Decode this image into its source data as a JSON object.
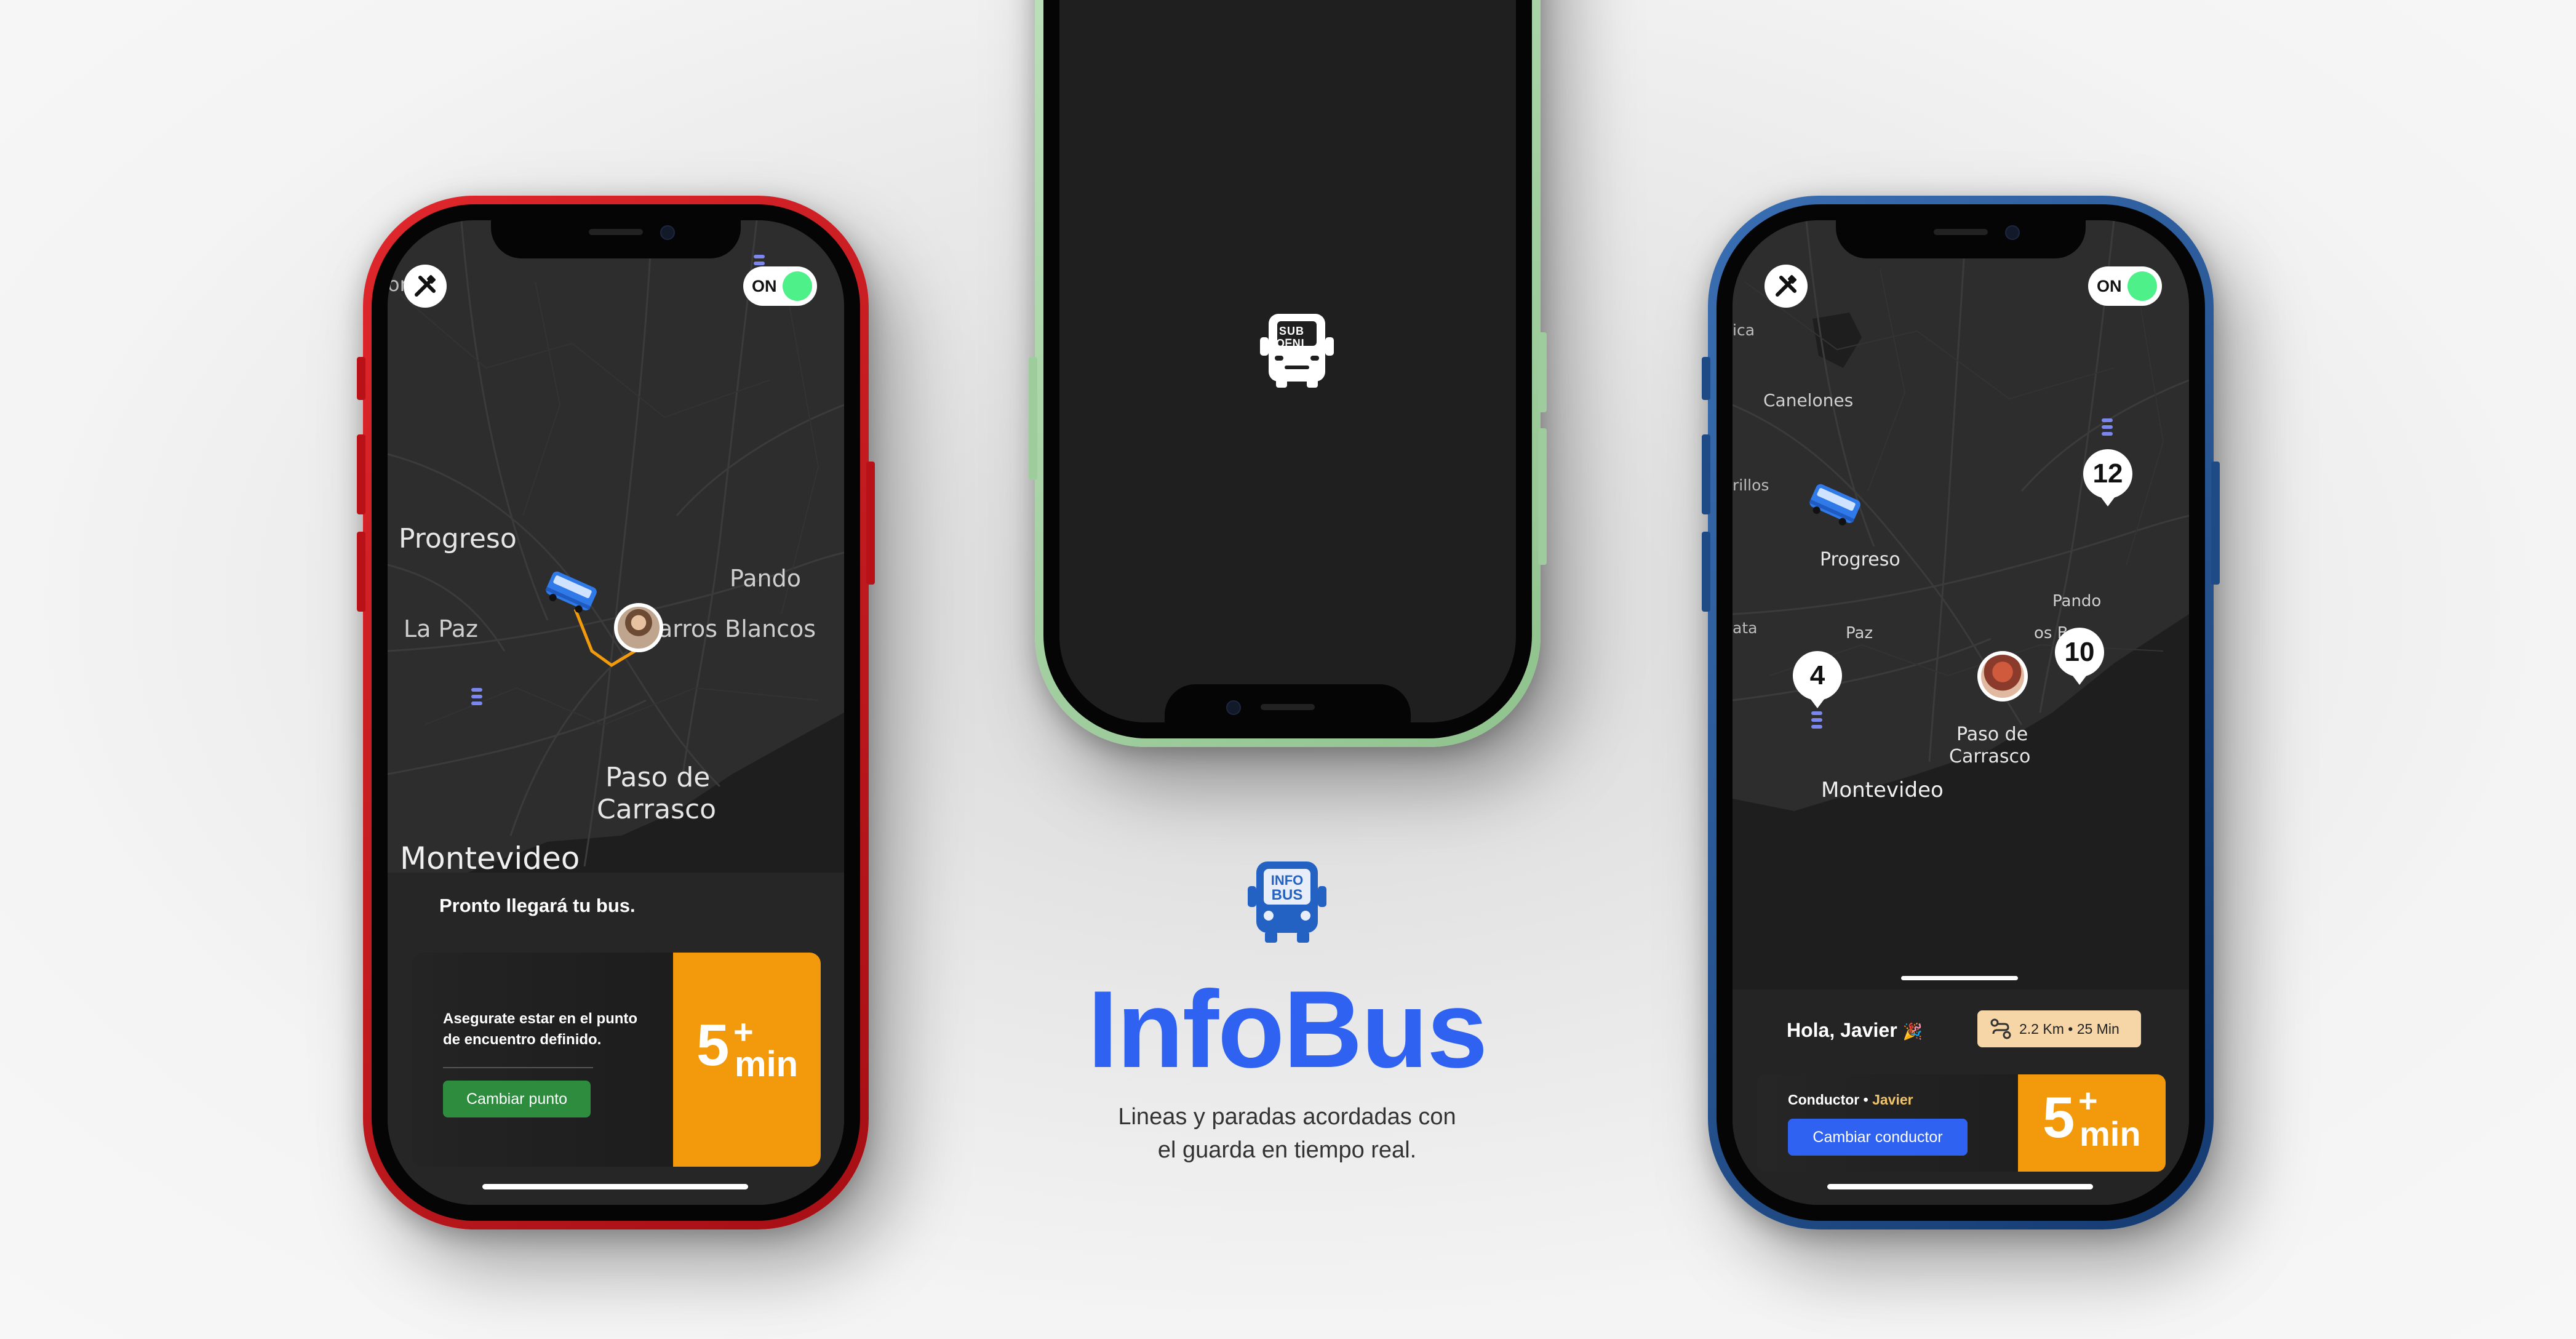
{
  "left_phone": {
    "map_labels": [
      "ones",
      "Progreso",
      "Pando",
      "La Paz",
      "arros Blancos",
      "Paso de",
      "Carrasco",
      "Montevideo"
    ],
    "toggle_label": "ON",
    "notice_text": "Pronto llegará tu bus.",
    "card_instruction_line1": "Asegurate estar en el punto",
    "card_instruction_line2": "de encuentro definido.",
    "change_point_button": "Cambiar punto",
    "eta_number": "5",
    "eta_plus": "+",
    "eta_unit": "min"
  },
  "center_phone": {
    "logo_text_line1": "OᖴNI",
    "logo_text_line2": "SUB"
  },
  "branding": {
    "logo_line1": "INFO",
    "logo_line2": "BUS",
    "title": "InfoBus",
    "subtitle_line1": "Lineas y paradas acordadas con",
    "subtitle_line2": "el guarda en tiempo real."
  },
  "right_phone": {
    "map_labels": [
      "ica",
      "Canelones",
      "rillos",
      "Progreso",
      "Pando",
      "ata",
      "Paz",
      "os B",
      "Paso de",
      "Carrasco",
      "Montevideo"
    ],
    "toggle_label": "ON",
    "pin_12": "12",
    "pin_10": "10",
    "pin_4": "4",
    "greeting": "Hola, Javier",
    "greeting_emoji": "🎉",
    "trip_info": "2.2 Km • 25 Min",
    "driver_label": "Conductor •",
    "driver_name": "Javier",
    "change_driver_button": "Cambiar conductor",
    "eta_number": "5",
    "eta_plus": "+",
    "eta_unit": "min"
  },
  "colors": {
    "brand_blue": "#2f62f1",
    "eta_orange": "#f29a0c",
    "change_point_green": "#2e8c3f",
    "change_driver_blue": "#2f62f1",
    "toggle_green": "#4ef08a",
    "left_frame_red": "#c4161c",
    "center_frame_green": "#a8d6a6",
    "right_frame_blue": "#1e4a86"
  }
}
